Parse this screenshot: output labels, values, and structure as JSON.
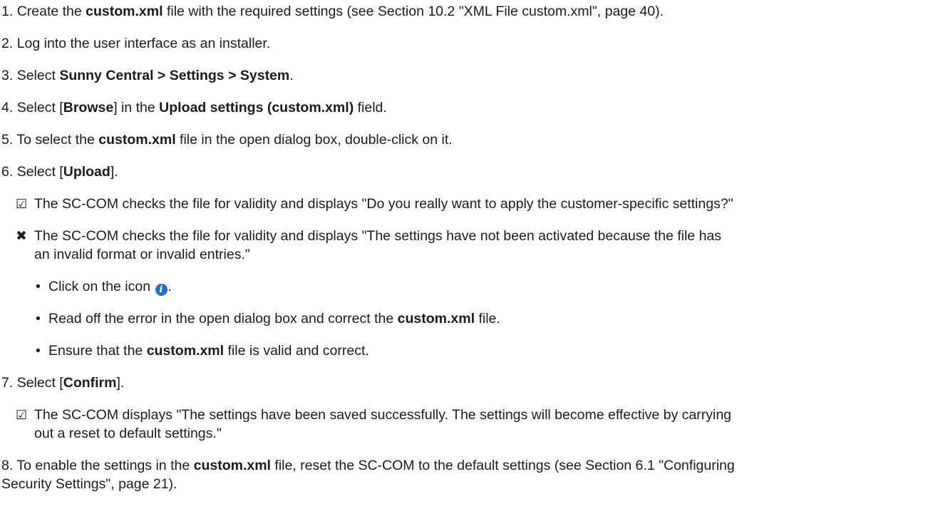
{
  "steps": {
    "s1": {
      "num": "1.",
      "a": "Create the",
      "b": "custom.xml",
      "c": "file with the required settings (see Section 10.2 \"XML File custom.xml\", page 40)."
    },
    "s2": {
      "num": "2.",
      "text": "Log into the user interface as an installer."
    },
    "s3": {
      "num": "3.",
      "a": "Select",
      "b": "Sunny Central > Settings > System",
      "c": "."
    },
    "s4": {
      "num": "4.",
      "a": "Select [",
      "b": "Browse",
      "c": "] in the",
      "d": "Upload settings (custom.xml)",
      "e": "field."
    },
    "s5": {
      "num": "5.",
      "a": "To select the",
      "b": "custom.xml",
      "c": "file in the open dialog box, double-click on it."
    },
    "s6": {
      "num": "6.",
      "a": "Select [",
      "b": "Upload",
      "c": "]."
    },
    "s6_ok": {
      "icon": "checkbox-checked-icon",
      "text": "The SC-COM checks the file for validity and displays \"Do you really want to apply the customer-specific settings?\""
    },
    "s6_err": {
      "icon": "cross-icon",
      "line1": "The SC-COM checks the file for validity and displays \"The settings have not been activated because the file has",
      "line2": "an invalid format or invalid entries.\""
    },
    "b1": {
      "a": "Click on the icon",
      "icon": "info-icon",
      "b": "."
    },
    "b2": {
      "a": "Read off the error in the open dialog box and correct the",
      "b": "custom.xml",
      "c": "file."
    },
    "b3": {
      "a": "Ensure that the",
      "b": "custom.xml",
      "c": "file is valid and correct."
    },
    "s7": {
      "num": "7.",
      "a": "Select [",
      "b": "Confirm",
      "c": "]."
    },
    "s7_ok": {
      "icon": "checkbox-checked-icon",
      "line1": "The SC-COM displays \"The settings have been saved successfully. The settings will become effective by carrying",
      "line2": "out a reset to default settings.\""
    },
    "s8": {
      "num": "8.",
      "a": "To enable the settings in the",
      "b": "custom.xml",
      "c": "file, reset the SC-COM to the default settings (see Section 6.1 \"Configuring",
      "line2": "Security Settings\", page 21)."
    }
  }
}
